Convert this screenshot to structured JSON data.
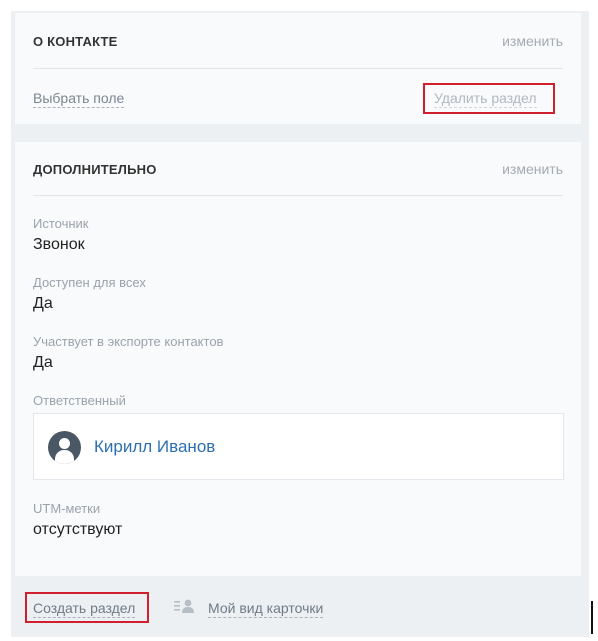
{
  "section_contact": {
    "title": "О КОНТАКТЕ",
    "edit_label": "изменить",
    "choose_field_label": "Выбрать поле",
    "delete_section_label": "Удалить раздел"
  },
  "section_extra": {
    "title": "ДОПОЛНИТЕЛЬНО",
    "edit_label": "изменить",
    "fields": [
      {
        "label": "Источник",
        "value": "Звонок"
      },
      {
        "label": "Доступен для всех",
        "value": "Да"
      },
      {
        "label": "Участвует в экспорте контактов",
        "value": "Да"
      },
      {
        "label": "Ответственный",
        "value": "Кирилл Иванов"
      },
      {
        "label": "UTM-метки",
        "value": "отсутствуют"
      }
    ]
  },
  "footer": {
    "create_section_label": "Создать раздел",
    "my_card_view_label": "Мой вид карточки"
  },
  "colors": {
    "highlight": "#d0202e",
    "link_blue": "#2d6fb0",
    "panel_bg": "#edf0f3",
    "card_bg": "#f9fafb"
  },
  "icons": {
    "user": "user-avatar-icon",
    "card_view": "card-view-icon"
  }
}
